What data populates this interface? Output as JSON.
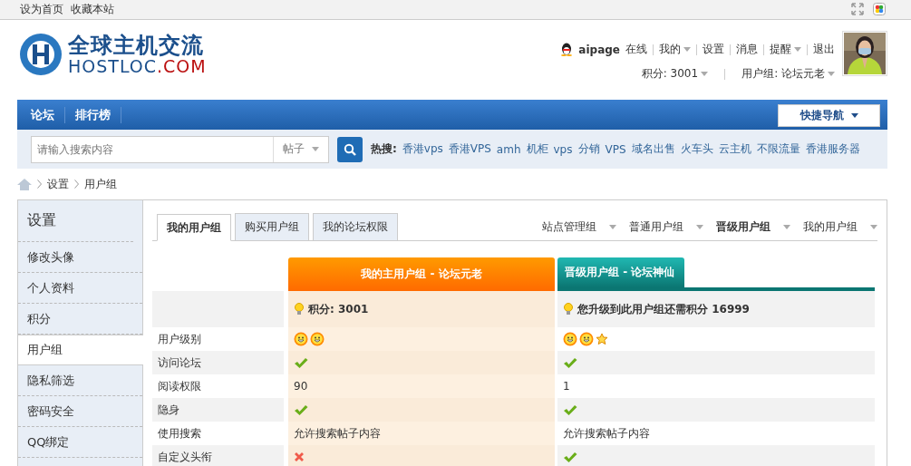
{
  "topbar": {
    "links": [
      "设为首页",
      "收藏本站"
    ]
  },
  "logo": {
    "title": "全球主机交流",
    "domain_a": "HOSTLOC",
    "domain_b": ".COM"
  },
  "user": {
    "name": "aipage",
    "status": "在线",
    "menu": [
      {
        "label": "我的",
        "dropdown": true
      },
      {
        "label": "设置",
        "dropdown": false
      },
      {
        "label": "消息",
        "dropdown": false
      },
      {
        "label": "提醒",
        "dropdown": true
      },
      {
        "label": "退出",
        "dropdown": false
      }
    ],
    "points": "积分: 3001",
    "group": "用户组: 论坛元老"
  },
  "nav": {
    "items": [
      "论坛",
      "排行榜"
    ],
    "quick": "快捷导航"
  },
  "search": {
    "placeholder": "请输入搜索内容",
    "type": "帖子",
    "hot_label": "热搜:",
    "hot": [
      "香港vps",
      "香港VPS",
      "amh",
      "机柜",
      "vps",
      "分销",
      "VPS",
      "域名出售",
      "火车头",
      "云主机",
      "不限流量",
      "香港服务器"
    ]
  },
  "breadcrumb": [
    "设置",
    "用户组"
  ],
  "sidebar": {
    "title": "设置",
    "items": [
      {
        "label": "修改头像",
        "selected": false
      },
      {
        "label": "个人资料",
        "selected": false
      },
      {
        "label": "积分",
        "selected": false
      },
      {
        "label": "用户组",
        "selected": true
      },
      {
        "label": "隐私筛选",
        "selected": false
      },
      {
        "label": "密码安全",
        "selected": false
      },
      {
        "label": "QQ绑定",
        "selected": false
      }
    ]
  },
  "tabs": [
    {
      "label": "我的用户组",
      "selected": true
    },
    {
      "label": "购买用户组",
      "selected": false
    },
    {
      "label": "我的论坛权限",
      "selected": false
    }
  ],
  "group_menus": [
    {
      "label": "站点管理组",
      "selected": false
    },
    {
      "label": "普通用户组",
      "selected": false
    },
    {
      "label": "晋级用户组",
      "selected": true
    },
    {
      "label": "我的用户组",
      "selected": false
    }
  ],
  "table": {
    "columns": [
      {
        "title": "我的主用户组 - 论坛元老",
        "kind": "current",
        "summary": "积分: 3001"
      },
      {
        "title": "晋级用户组 - 论坛神仙",
        "kind": "next",
        "summary": "您升级到此用户组还需积分 16999"
      }
    ],
    "rows": [
      {
        "label": "用户级别",
        "cells": [
          {
            "kind": "icons",
            "icons": [
              {
                "kind": "sun"
              },
              {
                "kind": "sun"
              }
            ]
          },
          {
            "kind": "icons",
            "icons": [
              {
                "kind": "sun"
              },
              {
                "kind": "sun"
              },
              {
                "kind": "star"
              }
            ]
          }
        ]
      },
      {
        "label": "访问论坛",
        "cells": [
          {
            "kind": "check"
          },
          {
            "kind": "check"
          }
        ]
      },
      {
        "label": "阅读权限",
        "cells": [
          {
            "kind": "text",
            "text": "90"
          },
          {
            "kind": "text",
            "text": "1"
          }
        ]
      },
      {
        "label": "隐身",
        "cells": [
          {
            "kind": "check"
          },
          {
            "kind": "check"
          }
        ]
      },
      {
        "label": "使用搜索",
        "cells": [
          {
            "kind": "text",
            "text": "允许搜索帖子内容"
          },
          {
            "kind": "text",
            "text": "允许搜索帖子内容"
          }
        ]
      },
      {
        "label": "自定义头衔",
        "cells": [
          {
            "kind": "cross"
          },
          {
            "kind": "check"
          }
        ]
      }
    ]
  }
}
